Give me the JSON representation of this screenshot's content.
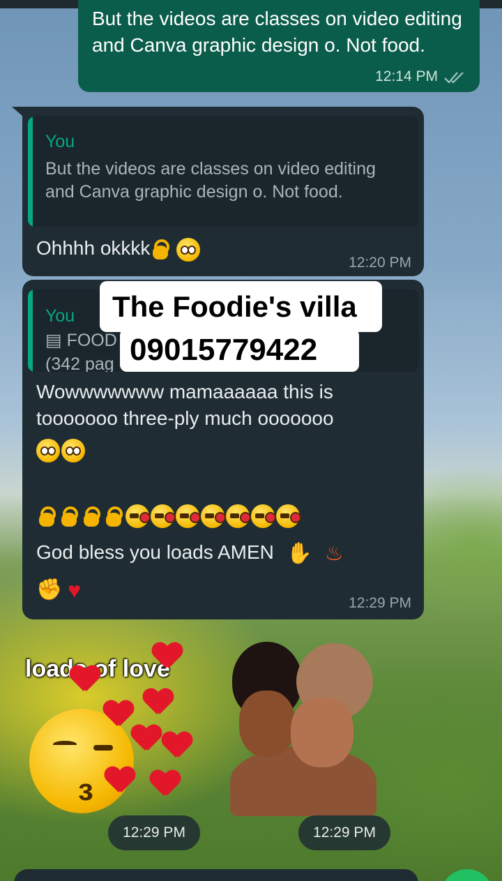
{
  "chat": {
    "outgoing": {
      "text": "But the videos are classes on video editing and Canva graphic design o. Not food.",
      "time": "12:14 PM"
    },
    "reply1": {
      "quote_author": "You",
      "quote_text": "But the videos are classes on video editing and Canva graphic design o. Not food.",
      "text": "Ohhhh okkkk",
      "time": "12:20 PM"
    },
    "reply2": {
      "quote_author": "You",
      "quote_doc": "FOOD",
      "quote_pages": "(342 pag",
      "line1": "Wowwwwwww mamaaaaaa this is",
      "line2": "tooooooo three-ply much ooooooo",
      "line3": "God bless you loads AMEN",
      "time": "12:29 PM"
    },
    "stickers": {
      "left_text": "loads of love",
      "left_time": "12:29 PM",
      "right_time": "12:29 PM"
    }
  },
  "overlay": {
    "line1": "The Foodie's villa",
    "line2": "09015779422"
  },
  "colors": {
    "outgoing_bubble": "#0b5d4b",
    "incoming_bubble": "#1f2c33",
    "accent": "#06a884"
  },
  "icons": [
    "double-check-icon",
    "document-icon",
    "thumbs-up-emoji",
    "smiling-hearts-emoji",
    "pleading-face-emoji",
    "ok-hand-emoji",
    "kissing-face-emoji",
    "praying-hands-emoji",
    "fire-emoji",
    "flexed-biceps-emoji",
    "red-heart-emoji"
  ]
}
